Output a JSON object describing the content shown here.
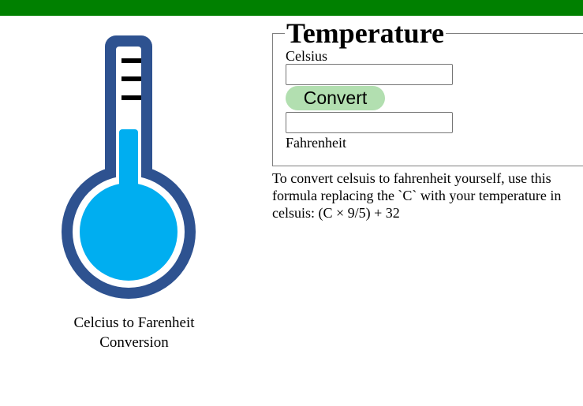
{
  "colors": {
    "topbar": "#008000",
    "thermometer_outline": "#2e5290",
    "mercury": "#00aef0",
    "button": "#b2dfb0"
  },
  "thermometer": {
    "caption": "Celcius to Farenheit Conversion"
  },
  "form": {
    "legend": "Temperature",
    "celsius_label": "Celsius",
    "celsius_value": "",
    "convert_label": "Convert",
    "fahrenheit_value": "",
    "fahrenheit_label": "Fahrenheit"
  },
  "help": {
    "formula_text": "To convert celsuis to fahrenheit yourself, use this formula replacing the `C` with your temperature in celsuis: (C × 9/5) + 32"
  }
}
